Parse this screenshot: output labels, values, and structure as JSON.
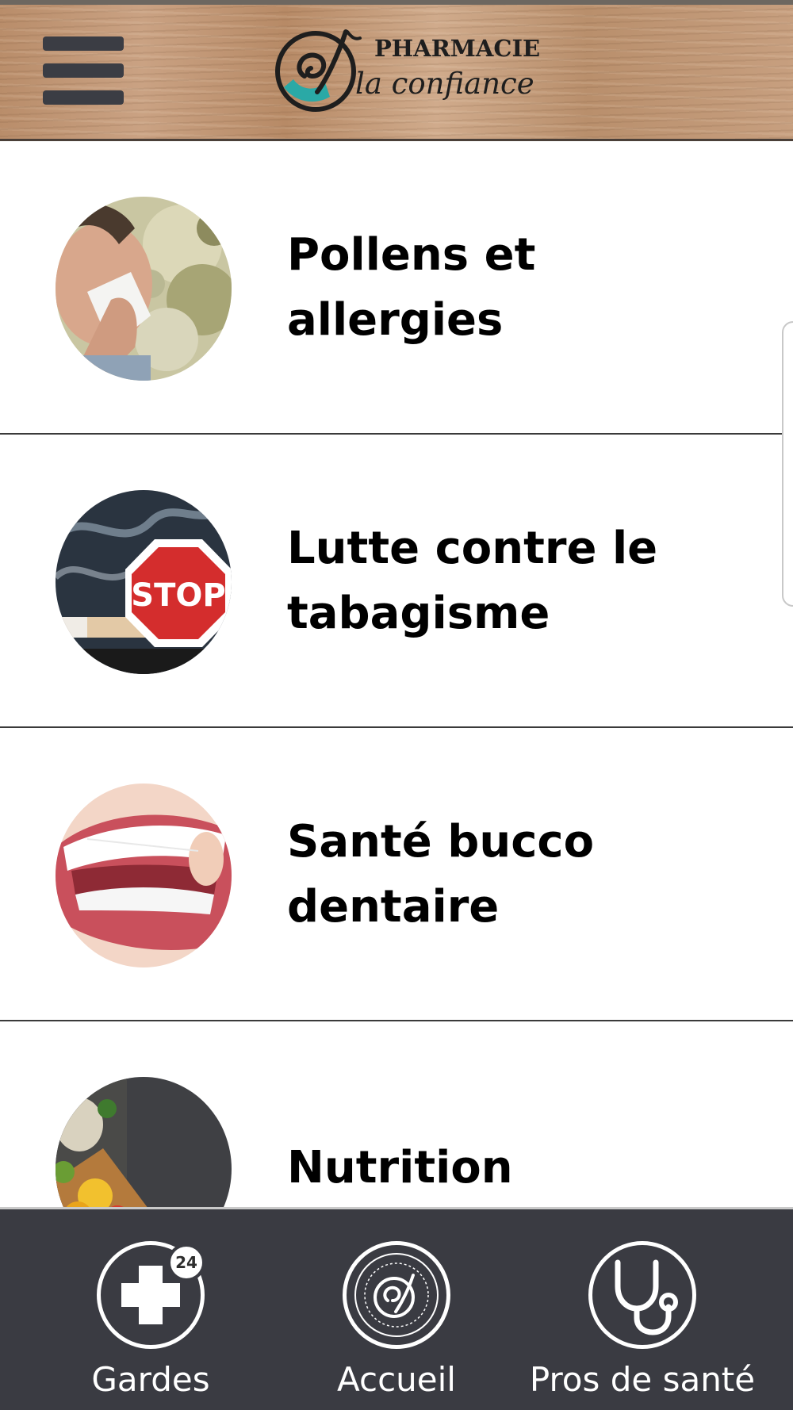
{
  "header": {
    "menu_icon": "hamburger-menu-icon",
    "logo_title": "PHARMACIE",
    "logo_subtitle": "la confiance"
  },
  "list": {
    "items": [
      {
        "title": "Pollens et allergies",
        "image": "person-sneezing-photo"
      },
      {
        "title": "Lutte contre le tabagisme",
        "image": "stop-sign-cigarette-photo"
      },
      {
        "title": "Santé bucco dentaire",
        "image": "smile-teeth-photo"
      },
      {
        "title": "Nutrition",
        "image": "vegetables-photo"
      }
    ]
  },
  "tabbar": {
    "tabs": [
      {
        "label": "Gardes",
        "icon": "medical-cross-icon",
        "badge": "24"
      },
      {
        "label": "Accueil",
        "icon": "pharmacy-logo-icon"
      },
      {
        "label": "Pros de santé",
        "icon": "stethoscope-icon"
      }
    ]
  },
  "colors": {
    "tabbar_bg": "#3a3b42",
    "text": "#000000",
    "logo_accent": "#2aa9a6"
  }
}
